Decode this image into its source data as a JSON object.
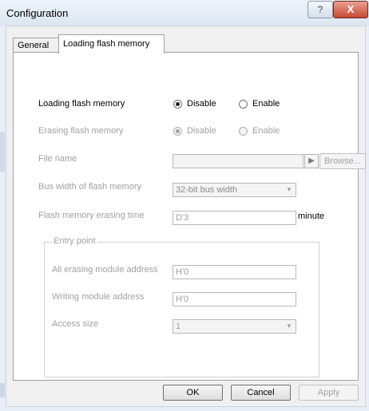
{
  "window": {
    "title": "Configuration",
    "help_glyph": "?",
    "close_glyph": "X"
  },
  "tabs": [
    {
      "label": "General",
      "active": false
    },
    {
      "label": "Loading flash memory",
      "active": true
    }
  ],
  "form": {
    "loading": {
      "label": "Loading flash memory",
      "opt_disable": "Disable",
      "opt_enable": "Enable",
      "selected": "Disable"
    },
    "erasing": {
      "label": "Erasing flash memory",
      "opt_disable": "Disable",
      "opt_enable": "Enable",
      "selected": "Disable"
    },
    "file_name": {
      "label": "File name",
      "value": "",
      "browse_label": "Browse..."
    },
    "bus_width": {
      "label": "Bus width of flash memory",
      "value": "32-bit bus width"
    },
    "erase_time": {
      "label": "Flash memory erasing time",
      "value": "D'3",
      "unit": "minute"
    },
    "entry_point": {
      "title": "Entry point",
      "all_erasing": {
        "label": "All erasing module address",
        "value": "H'0"
      },
      "writing": {
        "label": "Writing module address",
        "value": "H'0"
      },
      "access_size": {
        "label": "Access size",
        "value": "1"
      }
    }
  },
  "buttons": {
    "ok": "OK",
    "cancel": "Cancel",
    "apply": "Apply"
  },
  "icons": {
    "browse_arrow": "▶",
    "dropdown_arrow": "▼"
  }
}
